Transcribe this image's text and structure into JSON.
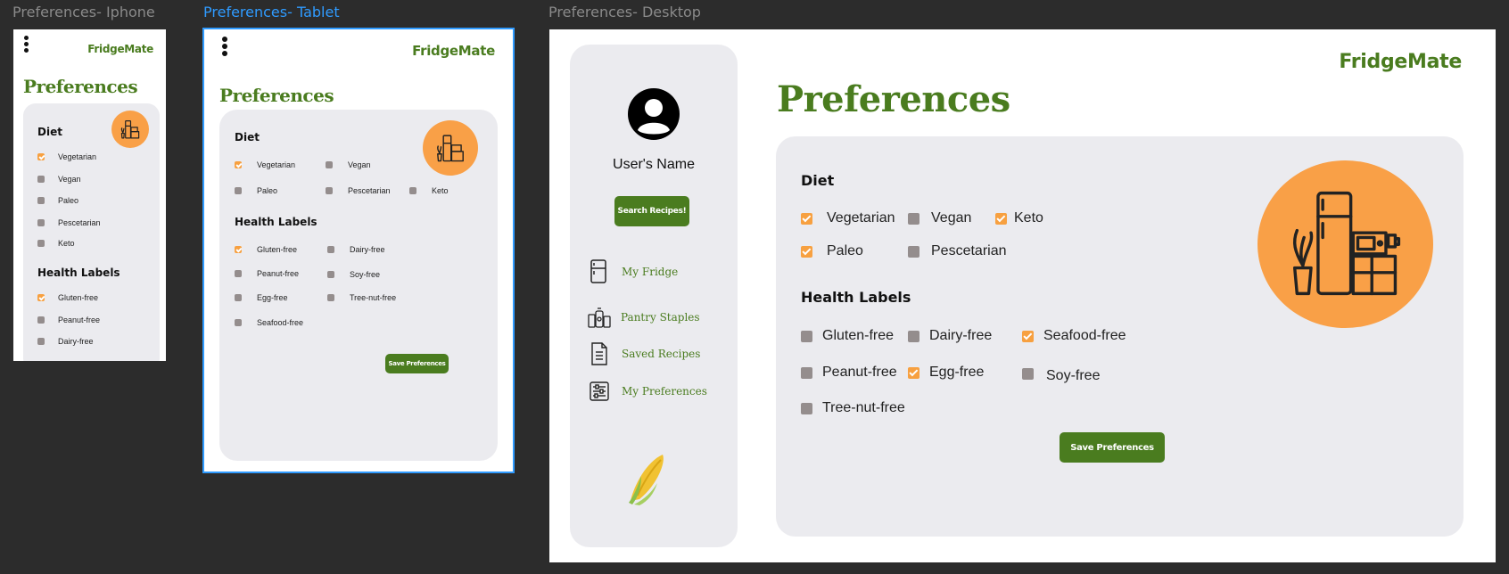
{
  "frames": {
    "iphone": {
      "label": "Preferences- Iphone"
    },
    "tablet": {
      "label": "Preferences- Tablet"
    },
    "desktop": {
      "label": "Preferences- Desktop"
    }
  },
  "brand": "FridgeMate",
  "page_title": "Preferences",
  "diet": {
    "heading": "Diet",
    "options": {
      "vegetarian": "Vegetarian",
      "vegan": "Vegan",
      "paleo": "Paleo",
      "pescetarian": "Pescetarian",
      "keto": "Keto"
    }
  },
  "health": {
    "heading": "Health Labels",
    "options": {
      "gluten_free": "Gluten-free",
      "dairy_free": "Dairy-free",
      "peanut_free": "Peanut-free",
      "soy_free": "Soy-free",
      "egg_free": "Egg-free",
      "tree_nut_free": "Tree-nut-free",
      "seafood_free": "Seafood-free"
    }
  },
  "checked": {
    "iphone": [
      "vegetarian",
      "gluten_free"
    ],
    "tablet": [
      "vegetarian",
      "gluten_free"
    ],
    "desktop": [
      "vegetarian",
      "keto",
      "paleo",
      "seafood_free",
      "egg_free"
    ]
  },
  "save_button": "Save Preferences",
  "sidebar": {
    "user_name": "User's Name",
    "search_button": "Search Recipes!",
    "items": [
      {
        "label": "My Fridge",
        "icon": "fridge-icon"
      },
      {
        "label": "Pantry Staples",
        "icon": "jars-icon"
      },
      {
        "label": "Saved Recipes",
        "icon": "document-icon"
      },
      {
        "label": "My Preferences",
        "icon": "sliders-icon"
      }
    ]
  },
  "colors": {
    "brand_green": "#4a7c1f",
    "accent_orange": "#f9a047",
    "card_gray": "#ebebef",
    "checkbox_off": "#948d8d",
    "canvas": "#2c2c2c"
  }
}
